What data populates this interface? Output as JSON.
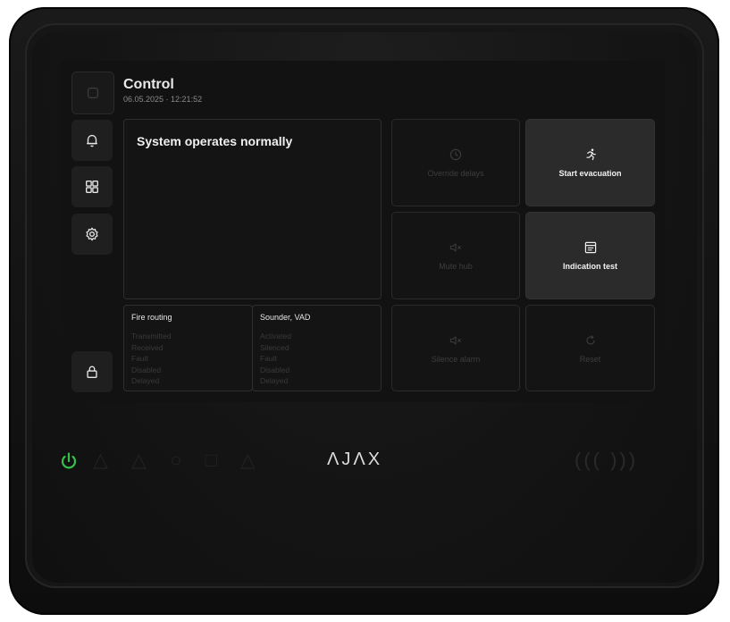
{
  "header": {
    "title": "Control",
    "datetime": "06.05.2025 · 12:21:52"
  },
  "sidebar": {
    "items": [
      {
        "icon": "square-icon"
      },
      {
        "icon": "bell-icon"
      },
      {
        "icon": "grid-icon"
      },
      {
        "icon": "gear-icon"
      },
      {
        "icon": "lock-icon"
      }
    ]
  },
  "status": {
    "text": "System operates normally"
  },
  "tiles": {
    "override_delays": "Override delays",
    "start_evacuation": "Start evacuation",
    "mute_hub": "Mute hub",
    "indication_test": "Indication test",
    "silence_alarm": "Silence alarm",
    "reset": "Reset"
  },
  "fire_routing": {
    "title": "Fire routing",
    "items": [
      "Transmitted",
      "Received",
      "Fault",
      "Disabled",
      "Delayed"
    ]
  },
  "sounder": {
    "title": "Sounder, VAD",
    "items": [
      "Activated",
      "Silenced",
      "Fault",
      "Disabled",
      "Delayed"
    ]
  },
  "device": {
    "logo": "ΛJΛX",
    "power_color": "#35c14a"
  }
}
